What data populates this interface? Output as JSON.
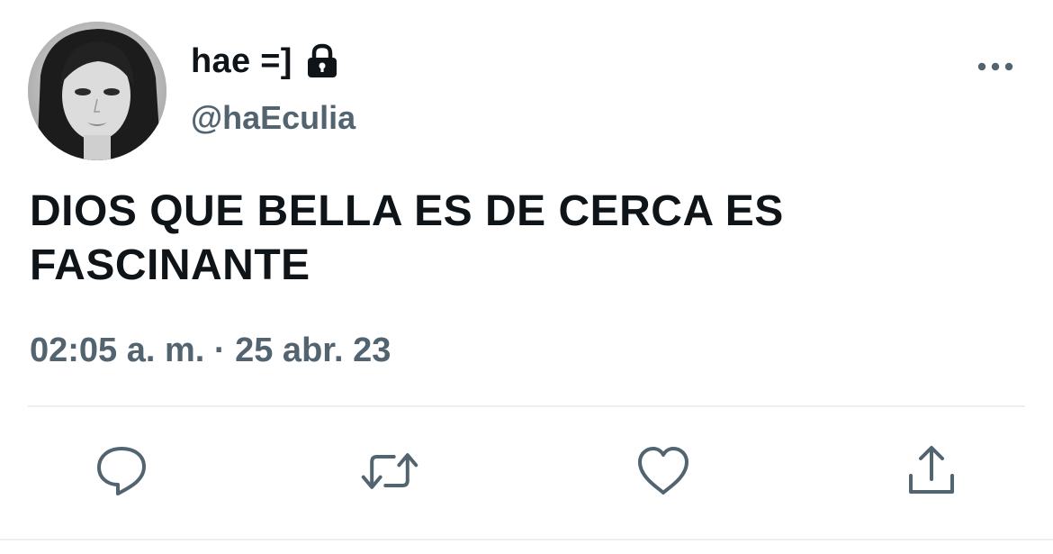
{
  "user": {
    "display_name": "hae =]",
    "handle": "@haEculia",
    "protected": true
  },
  "tweet": {
    "text": "DIOS QUE BELLA ES DE CERCA ES FASCINANTE",
    "timestamp": "02:05 a. m. · 25 abr. 23"
  },
  "icons": {
    "lock": "lock-icon",
    "more": "more-icon",
    "reply": "reply-icon",
    "retweet": "retweet-icon",
    "like": "heart-icon",
    "share": "share-icon"
  },
  "colors": {
    "text_primary": "#0f1419",
    "text_secondary": "#536471",
    "icon": "#536471",
    "divider": "#eceff1"
  }
}
